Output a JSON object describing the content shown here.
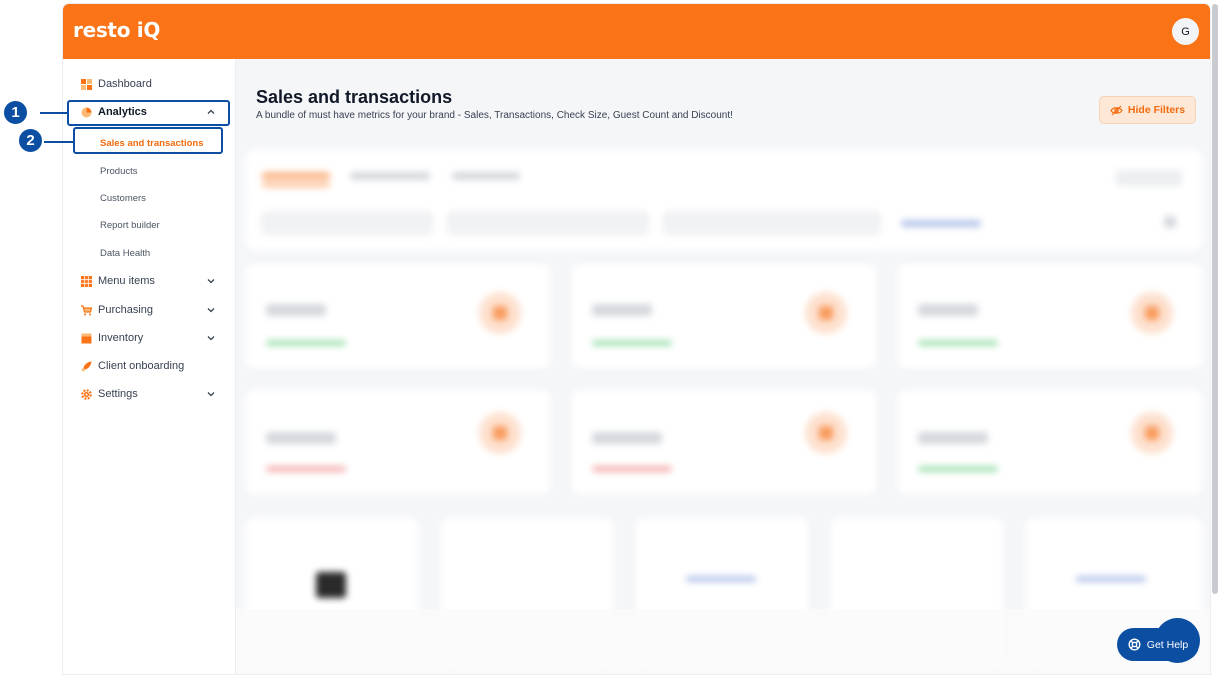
{
  "header": {
    "logo": "resto iQ",
    "avatar_initial": "G"
  },
  "sidebar": {
    "items": [
      {
        "label": "Dashboard",
        "icon": "dashboard-icon"
      },
      {
        "label": "Analytics",
        "icon": "pie-chart-icon",
        "expanded": true
      },
      {
        "label": "Menu items",
        "icon": "grid-icon"
      },
      {
        "label": "Purchasing",
        "icon": "cart-icon"
      },
      {
        "label": "Inventory",
        "icon": "box-icon"
      },
      {
        "label": "Client onboarding",
        "icon": "rocket-icon"
      },
      {
        "label": "Settings",
        "icon": "gear-icon"
      }
    ],
    "analytics_sub": [
      {
        "label": "Sales and transactions",
        "active": true
      },
      {
        "label": "Products"
      },
      {
        "label": "Customers"
      },
      {
        "label": "Report builder"
      },
      {
        "label": "Data Health"
      }
    ]
  },
  "callouts": [
    "1",
    "2"
  ],
  "main": {
    "title": "Sales and transactions",
    "subtitle": "A bundle of must have metrics for your brand - Sales, Transactions, Check Size, Guest Count and Discount!",
    "hide_filters_label": "Hide Filters"
  },
  "help": {
    "label": "Get Help"
  },
  "colors": {
    "brand": "#fa7316",
    "accent_blue": "#0b4ea2",
    "active_text": "#f26b0f"
  }
}
